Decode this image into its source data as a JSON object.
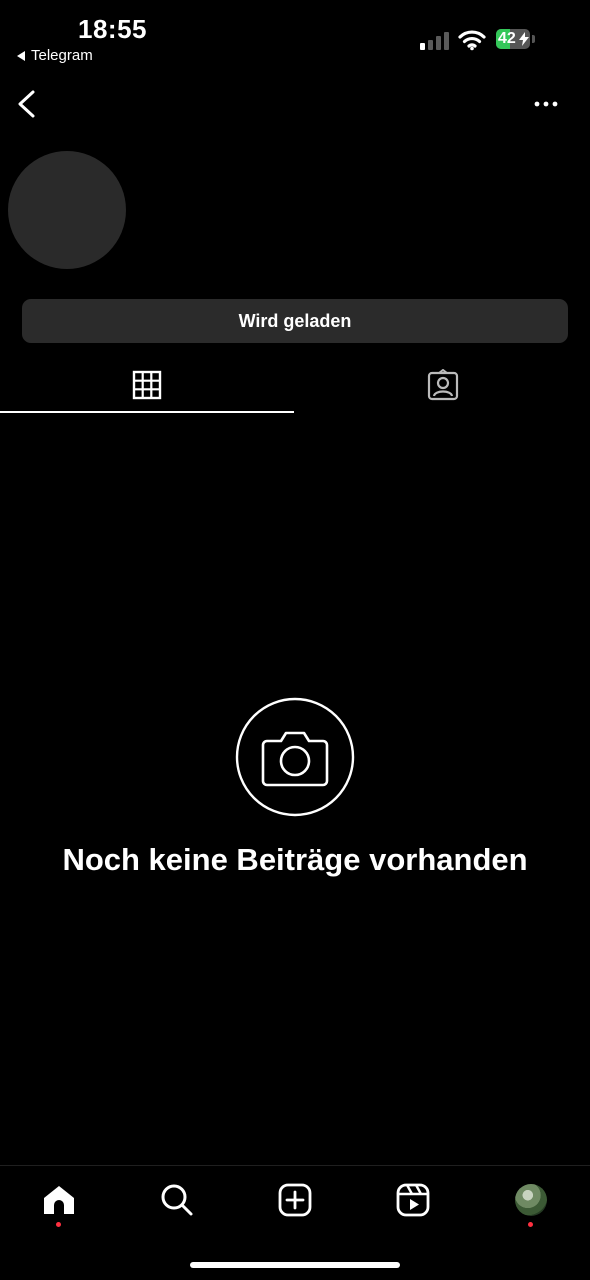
{
  "status_bar": {
    "time": "18:55",
    "back_app": "Telegram",
    "battery": "42",
    "battery_level_percent": 42,
    "signal_bars_active": 1,
    "signal_bars_total": 4
  },
  "header": {
    "back_icon": "chevron-left-icon",
    "more_icon": "ellipsis-icon"
  },
  "profile": {
    "load_button_label": "Wird geladen"
  },
  "tabs": [
    {
      "icon": "grid-icon",
      "active": true
    },
    {
      "icon": "tagged-person-icon",
      "active": false
    }
  ],
  "empty_state": {
    "icon": "camera-icon",
    "title": "Noch keine Beiträge vorhanden"
  },
  "bottom_nav": [
    {
      "icon": "home-icon",
      "active": true,
      "badge_dot": true
    },
    {
      "icon": "search-icon"
    },
    {
      "icon": "create-plus-icon"
    },
    {
      "icon": "reels-icon"
    },
    {
      "icon": "profile-avatar",
      "badge_dot": true
    }
  ],
  "colors": {
    "background": "#000000",
    "button_bg": "#2b2b2b",
    "avatar_placeholder": "#2a2a2a",
    "badge_dot": "#ff3040",
    "battery_green": "#34c759"
  }
}
